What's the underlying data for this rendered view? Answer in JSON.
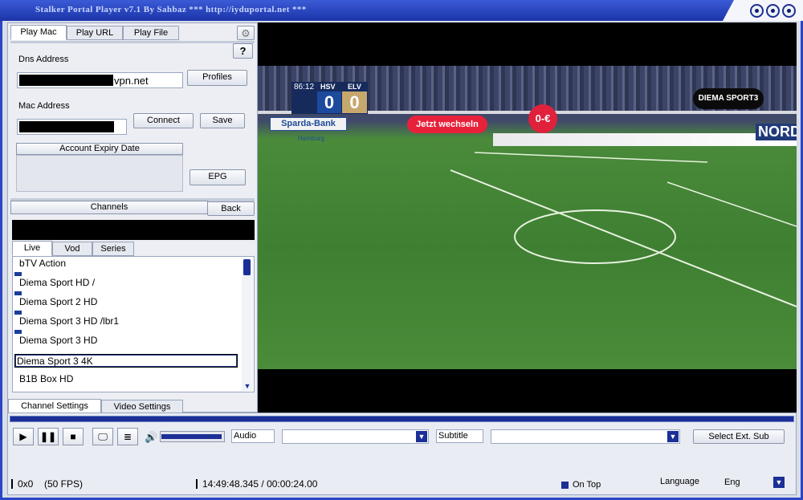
{
  "window": {
    "title": "Stalker Portal Player v7.1 By Sahbaz  *** http://iyduportal.net ***"
  },
  "top_tabs": [
    {
      "label": "Play Mac"
    },
    {
      "label": "Play URL"
    },
    {
      "label": "Play File"
    }
  ],
  "help_label": "?",
  "dns": {
    "label": "Dns Address",
    "value": "vpn.net"
  },
  "profiles_label": "Profiles",
  "mac": {
    "label": "Mac Address"
  },
  "connect_label": "Connect",
  "save_label": "Save",
  "account_expiry_label": "Account Expiry Date",
  "epg_label": "EPG",
  "channels_label": "Channels",
  "back_label": "Back",
  "list_tabs": [
    {
      "label": "Live"
    },
    {
      "label": "Vod"
    },
    {
      "label": "Series"
    }
  ],
  "channels": [
    {
      "name": "bTV Action"
    },
    {
      "name": "Diema Sport HD /"
    },
    {
      "name": "Diema Sport 2 HD"
    },
    {
      "name": "Diema Sport 3 HD /lbr1"
    },
    {
      "name": "Diema Sport 3 HD"
    },
    {
      "name": "Diema Sport 3 4K"
    },
    {
      "name": "B1B Box HD"
    }
  ],
  "selected_channel_index": 5,
  "settings_tabs": [
    {
      "label": "Channel Settings"
    },
    {
      "label": "Video Settings"
    }
  ],
  "video": {
    "score_time": "86:12",
    "team_home": "HSV",
    "team_away": "ELV",
    "score_home": "0",
    "score_away": "0",
    "channel_logo": "DIEMA SPORT3",
    "ad_banner_1": "Sparda-Bank",
    "ad_banner_2": "Jetzt wechseln",
    "ad_banner_3": "0-€",
    "ad_banner_4": "NORD",
    "ad_banner_5": "Hamburg"
  },
  "controls": {
    "audio_label": "Audio",
    "subtitle_label": "Subtitle",
    "select_sub_label": "Select Ext. Sub",
    "volume_level": 0.97
  },
  "status": {
    "resolution": "0x0",
    "fps": "(50 FPS)",
    "time": "14:49:48.345 / 00:00:24.00",
    "on_top": "On Top",
    "language_label": "Language",
    "language_value": "Eng"
  },
  "colors": {
    "title_bar": "#2036b8",
    "accent": "#1b2f96",
    "field_green": "#3f7f32"
  }
}
